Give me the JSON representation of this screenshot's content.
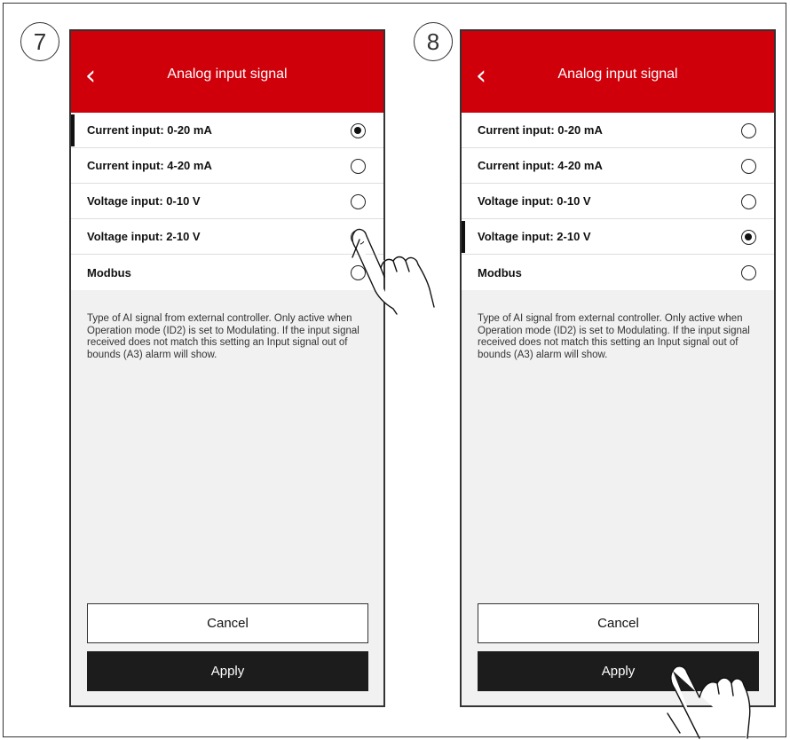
{
  "panels": [
    {
      "step": "7",
      "title": "Analog input signal",
      "options": [
        {
          "label": "Current input: 0-20 mA",
          "selected": true
        },
        {
          "label": "Current input: 4-20 mA",
          "selected": false
        },
        {
          "label": "Voltage input: 0-10 V",
          "selected": false
        },
        {
          "label": "Voltage input: 2-10 V",
          "selected": false
        },
        {
          "label": "Modbus",
          "selected": false
        }
      ],
      "description": "Type of AI signal from external controller. Only active when Operation mode (ID2) is set to Modulating. If the input signal received does not match this setting an Input signal out of bounds (A3) alarm will show.",
      "cancel_label": "Cancel",
      "apply_label": "Apply"
    },
    {
      "step": "8",
      "title": "Analog input signal",
      "options": [
        {
          "label": "Current input: 0-20 mA",
          "selected": false
        },
        {
          "label": "Current input: 4-20 mA",
          "selected": false
        },
        {
          "label": "Voltage input: 0-10 V",
          "selected": false
        },
        {
          "label": "Voltage input: 2-10 V",
          "selected": true
        },
        {
          "label": "Modbus",
          "selected": false
        }
      ],
      "description": "Type of AI signal from external controller. Only active when Operation mode (ID2) is set to Modulating. If the input signal received does not match this setting an Input signal out of bounds (A3) alarm will show.",
      "cancel_label": "Cancel",
      "apply_label": "Apply"
    }
  ],
  "colors": {
    "header_red": "#d0000b",
    "apply_button": "#1c1c1c",
    "background": "#f1f1f1"
  },
  "icons": {
    "back": "chevron-left-icon",
    "tap_gesture": "hand-pointer-icon"
  }
}
